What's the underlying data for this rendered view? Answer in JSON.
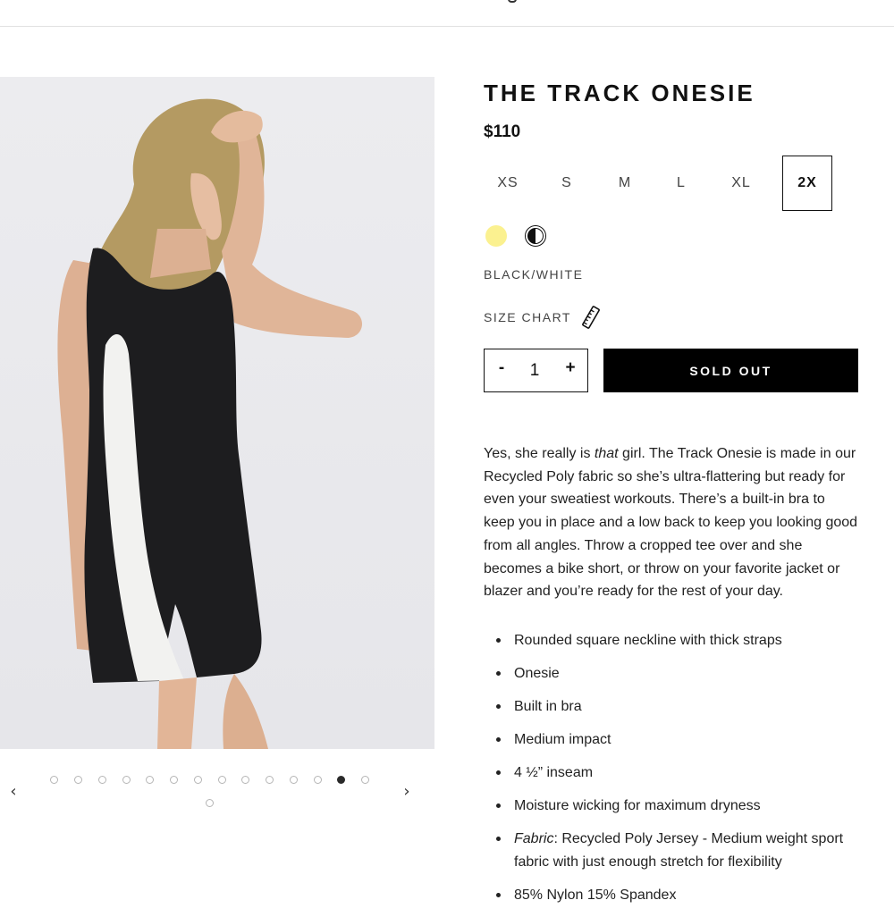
{
  "product": {
    "title": "THE TRACK ONESIE",
    "price": "$110",
    "sizes": [
      "XS",
      "S",
      "M",
      "L",
      "XL",
      "2X"
    ],
    "selected_size": "2X",
    "colors": [
      {
        "name": "yellow-swatch",
        "color": "#fbf190"
      },
      {
        "name": "black-white-swatch",
        "color": "#111111"
      }
    ],
    "selected_color_label": "BLACK/WHITE",
    "size_chart_label": "SIZE CHART",
    "size_chart_icon": "ruler-icon",
    "quantity": {
      "minus": "-",
      "value": "1",
      "plus": "+"
    },
    "add_button_label": "SOLD OUT",
    "description": {
      "before_em": "Yes, she really is ",
      "em": "that",
      "after_em": " girl. The Track Onesie is made in our Recycled Poly fabric so she’s ultra-flattering but ready for even your sweatiest workouts. There’s a built-in bra to keep you in place and a low back to keep you looking good from all angles. Throw a cropped tee over and she becomes a bike short, or throw on your favorite jacket or blazer and you’re ready for the rest of your day."
    },
    "features": [
      "Rounded square neckline with thick straps",
      "Onesie",
      "Built in bra",
      "Medium impact",
      "4 ½” inseam",
      "Moisture wicking for maximum dryness"
    ],
    "fabric_feature": {
      "label": "Fabric",
      "text": ": Recycled Poly Jersey - Medium weight sport fabric with just enough stretch for flexibility"
    },
    "composition_partial": "85% Nylon 15% Spandex"
  },
  "gallery": {
    "prev_icon": "‹",
    "next_icon": "›",
    "image_count": 15,
    "active_index": 12
  },
  "colors": {
    "accent_black": "#000000",
    "swatch_yellow": "#fbf190",
    "image_background": "#e9e9ec"
  }
}
